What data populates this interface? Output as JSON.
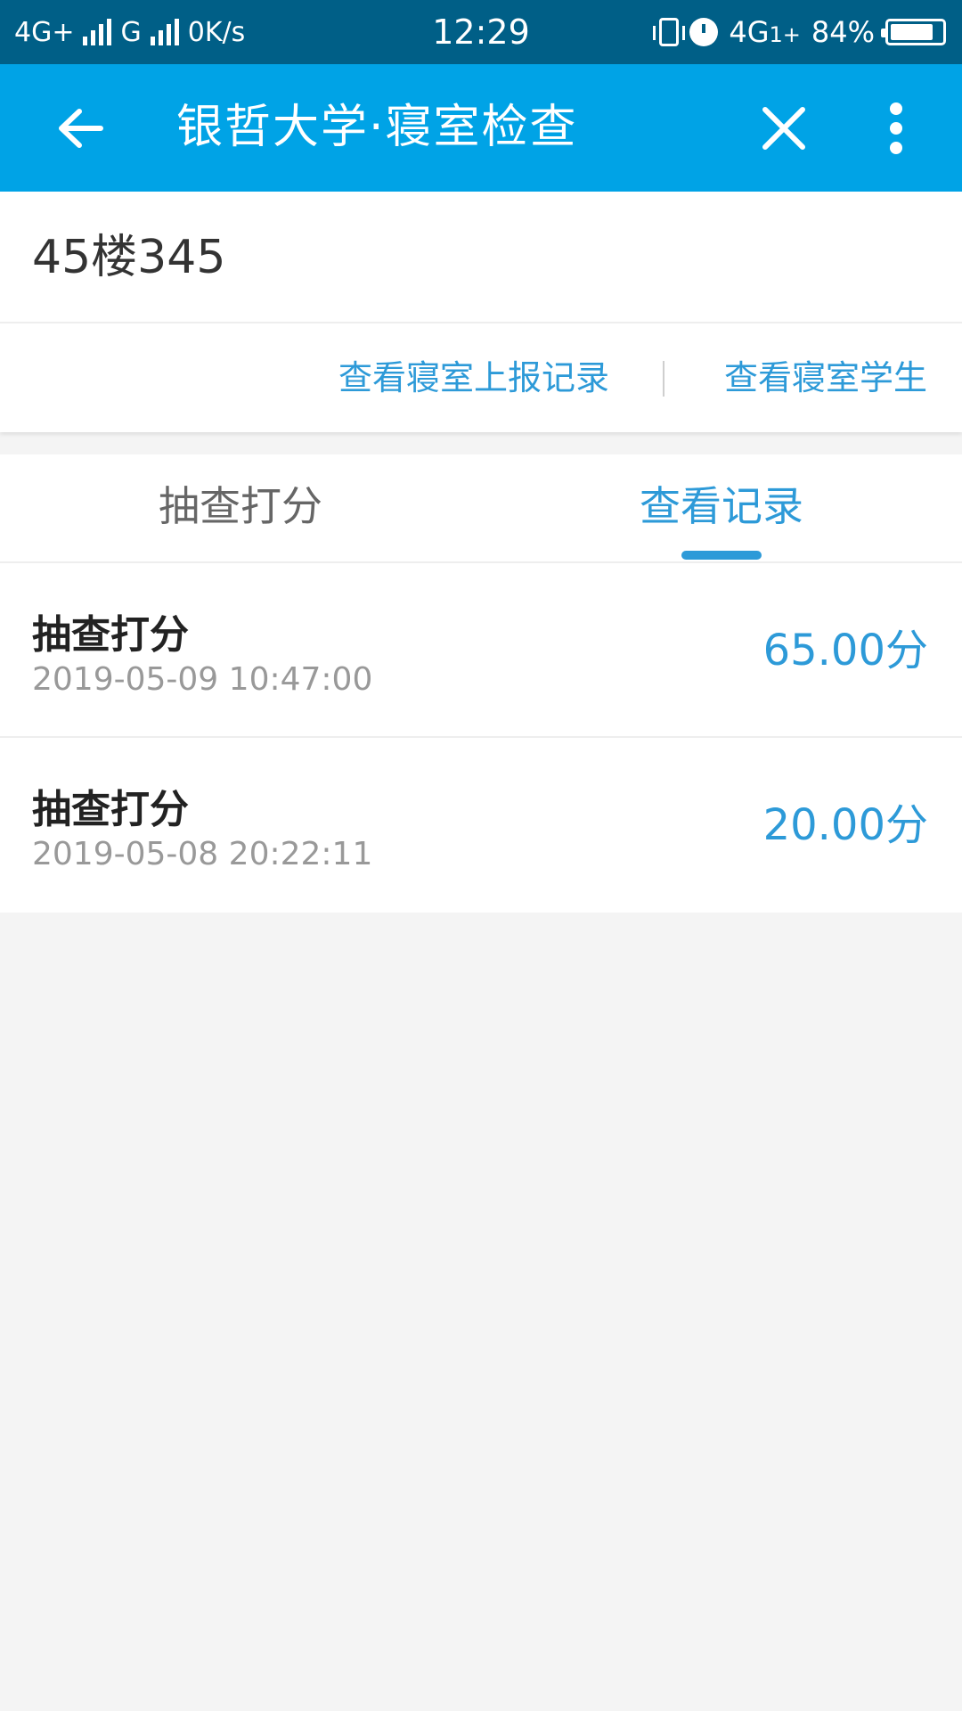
{
  "status_bar": {
    "network_left": "4G+",
    "carrier2": "G",
    "speed": "0K/s",
    "time": "12:29",
    "network_right": "4G",
    "network_right_suffix": "1+",
    "battery": "84%"
  },
  "app_bar": {
    "title": "银哲大学·寝室检查",
    "back_icon": "arrow-left-icon",
    "close_icon": "close-icon",
    "more_icon": "more-vertical-icon",
    "color": "#00a3e6"
  },
  "room": {
    "name": "45楼345",
    "link_reports": "查看寝室上报记录",
    "link_students": "查看寝室学生"
  },
  "tabs": [
    {
      "label": "抽查打分",
      "active": false
    },
    {
      "label": "查看记录",
      "active": true
    }
  ],
  "records": [
    {
      "title": "抽查打分",
      "time": "2019-05-09 10:47:00",
      "score": "65.00分"
    },
    {
      "title": "抽查打分",
      "time": "2019-05-08 20:22:11",
      "score": "20.00分"
    }
  ],
  "colors": {
    "accent": "#2d9ad8",
    "status_bar": "#005f87",
    "background": "#f4f4f4"
  }
}
